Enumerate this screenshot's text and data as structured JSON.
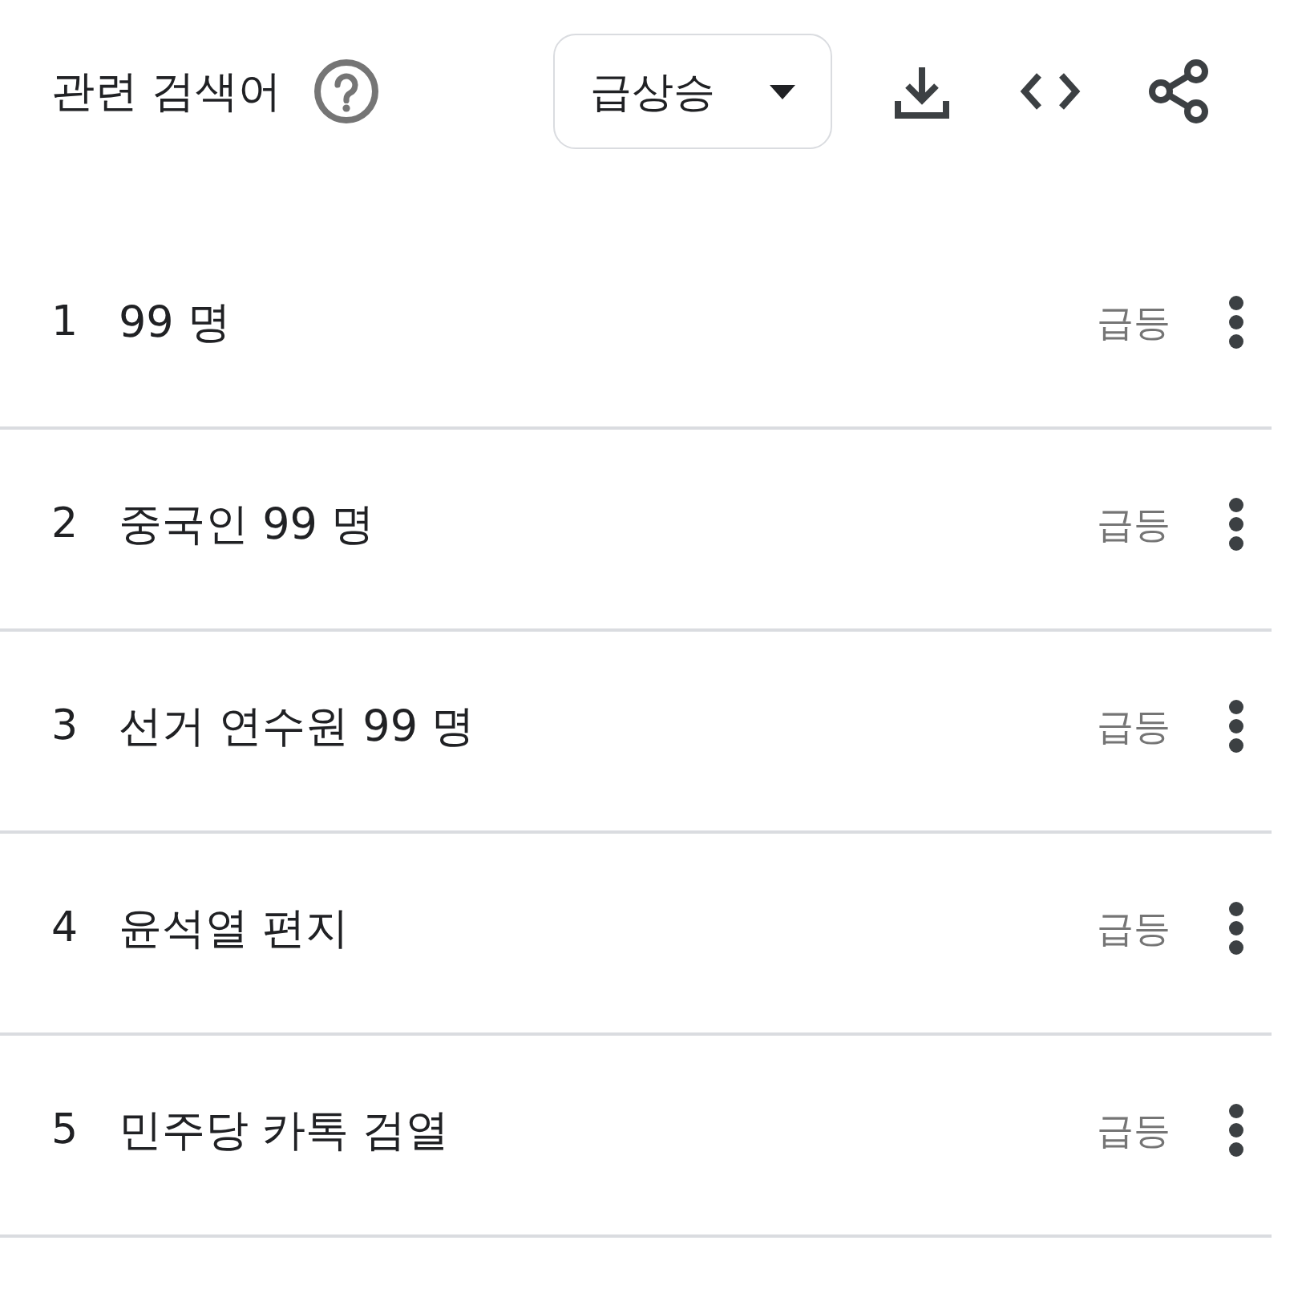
{
  "header": {
    "title": "관련 검색어",
    "dropdown": {
      "value": "급상승"
    }
  },
  "queries": [
    {
      "rank": "1",
      "text": "99 명",
      "change": "급등"
    },
    {
      "rank": "2",
      "text": "중국인 99 명",
      "change": "급등"
    },
    {
      "rank": "3",
      "text": "선거 연수원 99 명",
      "change": "급등"
    },
    {
      "rank": "4",
      "text": "윤석열 편지",
      "change": "급등"
    },
    {
      "rank": "5",
      "text": "민주당 카톡 검열",
      "change": "급등"
    }
  ]
}
